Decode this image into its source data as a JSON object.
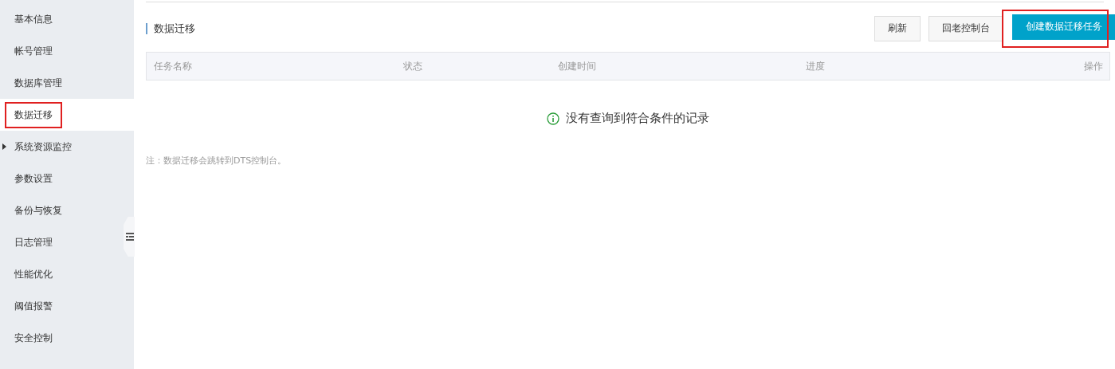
{
  "sidebar": {
    "items": [
      {
        "label": "基本信息",
        "selected": false,
        "kind": "link",
        "highlighted": false
      },
      {
        "label": "帐号管理",
        "selected": false,
        "kind": "link",
        "highlighted": false
      },
      {
        "label": "数据库管理",
        "selected": false,
        "kind": "link",
        "highlighted": false
      },
      {
        "label": "数据迁移",
        "selected": true,
        "kind": "link",
        "highlighted": true
      },
      {
        "label": "系统资源监控",
        "selected": false,
        "kind": "group",
        "highlighted": false
      },
      {
        "label": "参数设置",
        "selected": false,
        "kind": "link",
        "highlighted": false
      },
      {
        "label": "备份与恢复",
        "selected": false,
        "kind": "link",
        "highlighted": false
      },
      {
        "label": "日志管理",
        "selected": false,
        "kind": "link",
        "highlighted": false
      },
      {
        "label": "性能优化",
        "selected": false,
        "kind": "link",
        "highlighted": false
      },
      {
        "label": "阈值报警",
        "selected": false,
        "kind": "link",
        "highlighted": false
      },
      {
        "label": "安全控制",
        "selected": false,
        "kind": "link",
        "highlighted": false
      }
    ]
  },
  "page": {
    "title": "数据迁移",
    "buttons": [
      {
        "label": "刷新",
        "kind": "default",
        "highlighted": false
      },
      {
        "label": "回老控制台",
        "kind": "default",
        "highlighted": false
      },
      {
        "label": "创建数据迁移任务",
        "kind": "primary",
        "highlighted": true
      }
    ]
  },
  "table": {
    "columns": [
      "任务名称",
      "状态",
      "创建时间",
      "进度",
      "操作"
    ],
    "empty_message": "没有查询到符合条件的记录"
  },
  "note": "注：数据迁移会跳转到DTS控制台。"
}
